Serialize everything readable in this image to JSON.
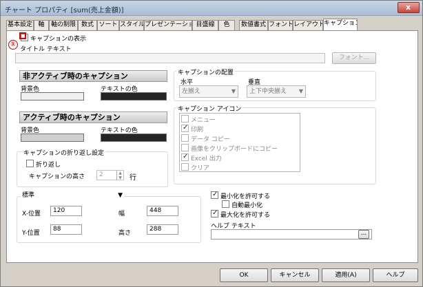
{
  "window": {
    "title": "チャート プロパティ [sum(売上金額)]",
    "close": "x"
  },
  "tabs": [
    "基本設定",
    "軸",
    "軸の制限",
    "数式",
    "ソート",
    "スタイル",
    "プレゼンテーション",
    "目盛線",
    "色",
    "数値書式",
    "フォント",
    "レイアウト",
    "キャプション"
  ],
  "active_tab": "キャプション",
  "annotation": {
    "marker": "①"
  },
  "caption": {
    "show_label": "キャプションの表示",
    "show_checked": false,
    "title_label": "タイトル テキスト",
    "title_value": "",
    "font_button": "フォント..."
  },
  "inactive": {
    "header": "非アクティブ時のキャプション",
    "bg_label": "背景色",
    "text_label": "テキストの色",
    "bg_color": "#f0f0f0",
    "text_color": "#252525"
  },
  "active": {
    "header": "アクティブ時のキャプション",
    "bg_label": "背景色",
    "text_label": "テキストの色",
    "bg_color": "#cfcfcf",
    "text_color": "#252525"
  },
  "wrap": {
    "group_title": "キャプションの折り返し設定",
    "wrap_label": "折り返し",
    "wrap_checked": false,
    "height_label": "キャプションの高さ",
    "height_value": "2",
    "unit": "行"
  },
  "placement": {
    "group_title": "キャプションの配置",
    "horizontal_label": "水平",
    "horizontal_value": "左揃え",
    "vertical_label": "垂直",
    "vertical_value": "上下中央揃え"
  },
  "icons": {
    "group_title": "キャプション アイコン",
    "items": [
      {
        "label": "メニュー",
        "checked": false
      },
      {
        "label": "印刷",
        "checked": true
      },
      {
        "label": "データ コピー",
        "checked": false
      },
      {
        "label": "画像をクリップボードにコピー",
        "checked": false
      },
      {
        "label": "Excel 出力",
        "checked": true
      },
      {
        "label": "クリア",
        "checked": false
      }
    ]
  },
  "position": {
    "dropdown_value": "標準",
    "x_label": "X-位置",
    "x_value": "120",
    "y_label": "Y-位置",
    "y_value": "88",
    "width_label": "幅",
    "width_value": "448",
    "height_label": "高さ",
    "height_value": "288"
  },
  "options": {
    "allow_minimize_label": "最小化を許可する",
    "allow_minimize": true,
    "auto_minimize_label": "自動最小化",
    "auto_minimize": false,
    "allow_maximize_label": "最大化を許可する",
    "allow_maximize": true,
    "help_label": "ヘルプ テキスト",
    "help_value": "",
    "help_button": "..."
  },
  "buttons": {
    "ok": "OK",
    "cancel": "キャンセル",
    "apply": "適用(A)",
    "help": "ヘルプ"
  }
}
